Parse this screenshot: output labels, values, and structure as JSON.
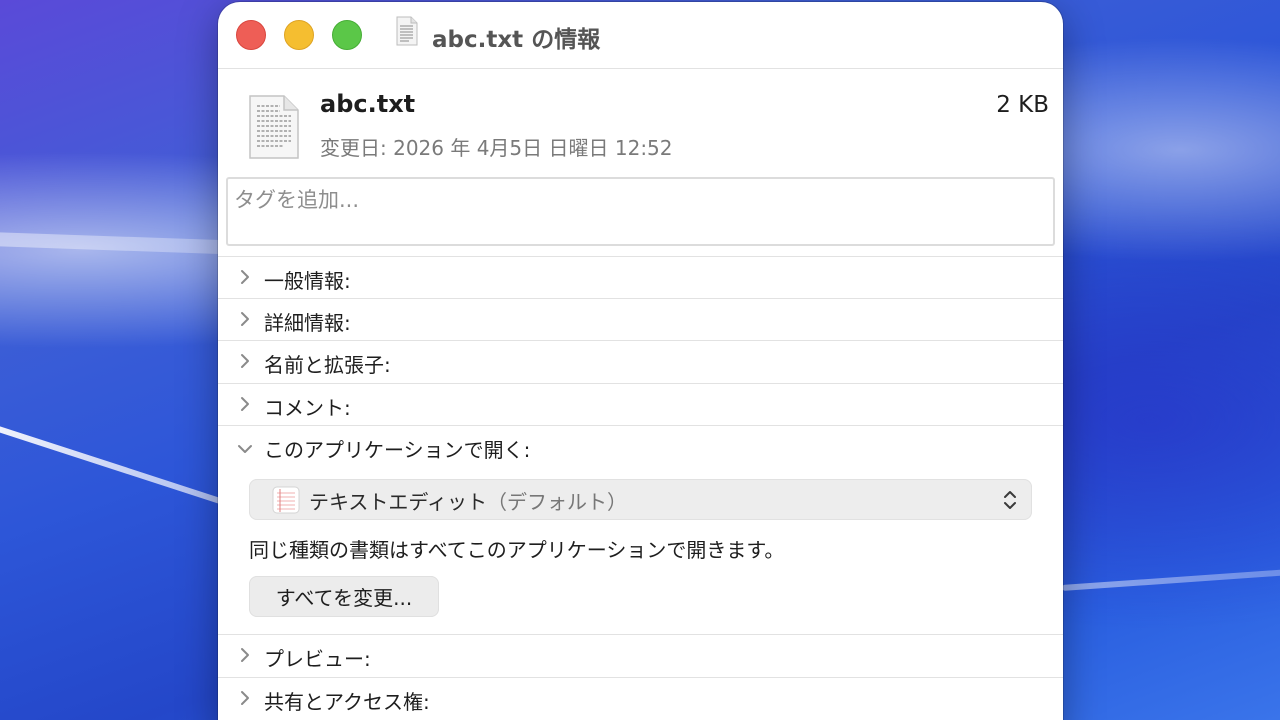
{
  "window": {
    "title": "abc.txt の情報"
  },
  "file": {
    "name": "abc.txt",
    "size": "2 KB",
    "modified": "変更日: 2026 年 4月5日 日曜日 12:52"
  },
  "tags": {
    "placeholder": "タグを追加..."
  },
  "sections": [
    {
      "label": "一般情報:",
      "expanded": false
    },
    {
      "label": "詳細情報:",
      "expanded": false
    },
    {
      "label": "名前と拡張子:",
      "expanded": false
    },
    {
      "label": "コメント:",
      "expanded": false
    },
    {
      "label": "このアプリケーションで開く:",
      "expanded": true
    },
    {
      "label": "プレビュー:",
      "expanded": false
    },
    {
      "label": "共有とアクセス権:",
      "expanded": false
    }
  ],
  "open_with": {
    "app_name": "テキストエディット",
    "app_suffix": "（デフォルト）",
    "info": "同じ種類の書類はすべてこのアプリケーションで開きます。",
    "change_all_label": "すべてを変更..."
  },
  "icons": {
    "traffic_close": "close-icon",
    "traffic_minimize": "minimize-icon",
    "traffic_maximize": "maximize-icon",
    "document": "document-icon",
    "chevron_right": "chevron-right-icon",
    "chevron_down": "chevron-down-icon",
    "up_down": "up-down-chevron-icon",
    "textedit": "textedit-app-icon"
  },
  "colors": {
    "close": "#ee5e56",
    "minimize": "#f5be30",
    "maximize": "#5bc748"
  }
}
